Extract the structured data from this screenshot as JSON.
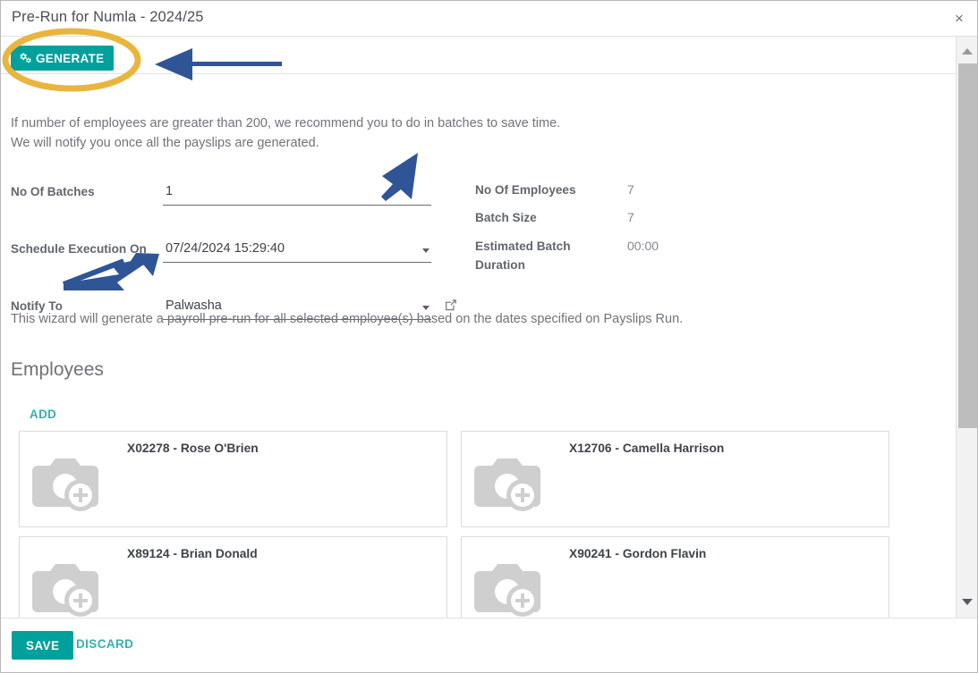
{
  "dialog": {
    "title": "Pre-Run for Numla - 2024/25",
    "close_label": "×"
  },
  "toolbar": {
    "generate_label": "GENERATE",
    "generate_icon": "cogs-icon"
  },
  "notes": {
    "line1": "If number of employees are greater than 200, we recommend you to do in batches to save time.",
    "line2": "We will notify you once all the payslips are generated.",
    "wizard": "This wizard will generate a payroll pre-run for all selected employee(s) based on the dates specified on Payslips Run."
  },
  "form": {
    "fields": [
      {
        "label": "No Of Batches",
        "value": "1",
        "type": "text",
        "has_caret": false
      },
      {
        "label": "Schedule Execution On",
        "value": "07/24/2024 15:29:40",
        "type": "datetime",
        "has_caret": true
      },
      {
        "label": "Notify To",
        "value": "Palwasha",
        "type": "select",
        "has_caret": true,
        "has_external_link": true
      }
    ]
  },
  "info": {
    "rows": [
      {
        "label": "No Of Employees",
        "value": "7"
      },
      {
        "label": "Batch Size",
        "value": "7"
      },
      {
        "label": "Estimated Batch Duration",
        "value": "00:00"
      }
    ]
  },
  "employees": {
    "section_title": "Employees",
    "add_label": "ADD",
    "cards": [
      {
        "name": "X02278 - Rose O'Brien",
        "avatar": "camera-placeholder-icon"
      },
      {
        "name": "X12706 - Camella Harrison",
        "avatar": "camera-placeholder-icon"
      },
      {
        "name": "X89124 - Brian Donald",
        "avatar": "camera-placeholder-icon"
      },
      {
        "name": "X90241 - Gordon Flavin",
        "avatar": "camera-placeholder-icon"
      }
    ]
  },
  "footer": {
    "save_label": "SAVE",
    "discard_label": "DISCARD"
  },
  "colors": {
    "accent_teal": "#00a09d",
    "link_teal": "#35b2ab",
    "label_gray": "#62666d",
    "annotation_blue": "#2f5597",
    "annotation_yellow": "#e8b63d"
  }
}
